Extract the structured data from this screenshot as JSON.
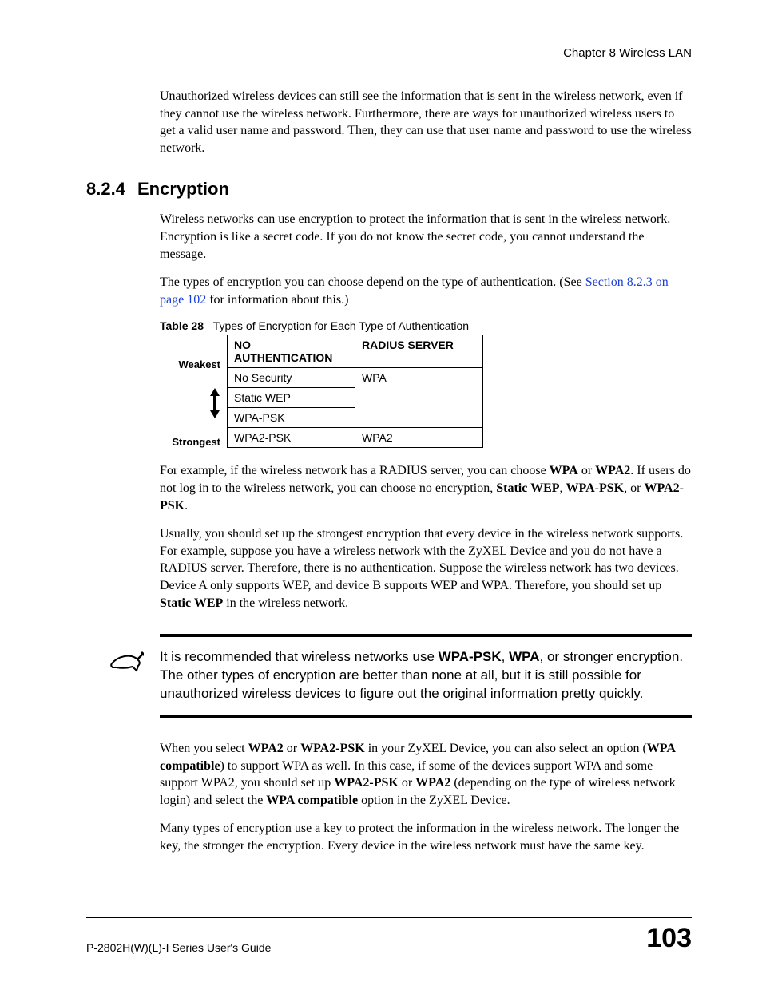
{
  "header": {
    "chapter": "Chapter 8 Wireless LAN"
  },
  "intro_para": "Unauthorized wireless devices can still see the information that is sent in the wireless network, even if they cannot use the wireless network. Furthermore, there are ways for unauthorized wireless users to get a valid user name and password. Then, they can use that user name and password to use the wireless network.",
  "section": {
    "number": "8.2.4",
    "title": "Encryption"
  },
  "enc_para1": "Wireless networks can use encryption to protect the information that is sent in the wireless network. Encryption is like a secret code. If you do not know the secret code, you cannot understand the message.",
  "enc_para2_pre": "The types of encryption you can choose depend on the type of authentication. (See ",
  "enc_para2_link": "Section 8.2.3 on page 102",
  "enc_para2_post": " for information about this.)",
  "table": {
    "caption_label": "Table 28",
    "caption_text": "Types of Encryption for Each Type of Authentication",
    "head_col1": "NO AUTHENTICATION",
    "head_col2": "RADIUS SERVER",
    "label_weakest": "Weakest",
    "label_strongest": "Strongest",
    "r1c1": "No Security",
    "r1c2": "WPA",
    "r2c1": "Static WEP",
    "r3c1": "WPA-PSK",
    "r4c1": "WPA2-PSK",
    "r4c2": "WPA2"
  },
  "para3_a": "For example, if the wireless network has a RADIUS server, you can choose ",
  "para3_wpa": "WPA",
  "para3_or1": " or ",
  "para3_wpa2": "WPA2",
  "para3_b": ". If users do not log in to the wireless network, you can choose no encryption, ",
  "para3_swep": "Static WEP",
  "para3_c": ", ",
  "para3_wpapsk": "WPA-PSK",
  "para3_or2": ", or ",
  "para3_wpa2psk": "WPA2-PSK",
  "para3_end": ".",
  "para4_a": "Usually, you should set up the strongest encryption that every device in the wireless network supports. For example, suppose you have a wireless network with the ZyXEL Device and you do not have a RADIUS server. Therefore, there is no authentication. Suppose the wireless network has two devices. Device A only supports WEP, and device B supports WEP and WPA. Therefore, you should set up ",
  "para4_swep": "Static WEP",
  "para4_b": " in the wireless network.",
  "note_a": "It is recommended that wireless networks use ",
  "note_wpapsk": "WPA-PSK",
  "note_c1": ", ",
  "note_wpa": "WPA",
  "note_b": ", or stronger encryption. The other types of encryption are better than none at all, but it is still possible for unauthorized wireless devices to figure out the original information pretty quickly.",
  "para5_a": "When you select ",
  "para5_wpa2": "WPA2",
  "para5_or": " or ",
  "para5_wpa2psk": "WPA2-PSK",
  "para5_b": " in your ZyXEL Device, you can also select an option (",
  "para5_wpacompat1": "WPA compatible",
  "para5_c": ") to support WPA as well. In this case, if some of the devices support WPA and some support WPA2, you should set up ",
  "para5_wpa2psk2": "WPA2-PSK",
  "para5_or2": " or ",
  "para5_wpa2_2": "WPA2",
  "para5_d": " (depending on the type of wireless network login) and select the ",
  "para5_wpacompat2": "WPA compatible",
  "para5_e": " option in the ZyXEL Device.",
  "para6": "Many types of encryption use a key to protect the information in the wireless network. The longer the key, the stronger the encryption. Every device in the wireless network must have the same key.",
  "footer": {
    "guide": "P-2802H(W)(L)-I Series User's Guide",
    "page": "103"
  }
}
